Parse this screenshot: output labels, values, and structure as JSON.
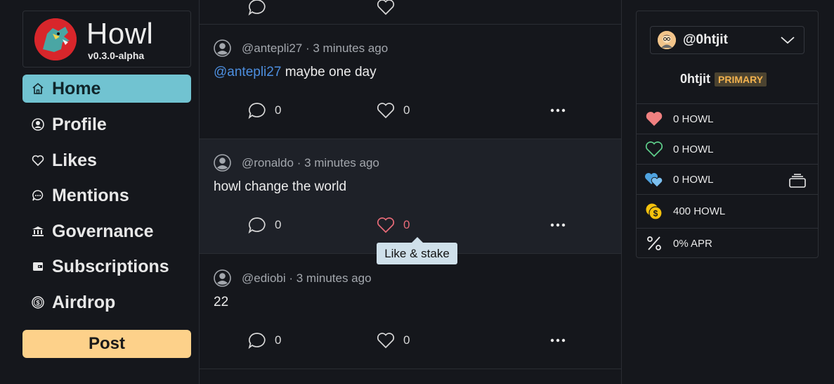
{
  "brand": {
    "name": "Howl",
    "version": "v0.3.0-alpha"
  },
  "nav": [
    {
      "label": "Home",
      "icon": "home-icon",
      "active": true
    },
    {
      "label": "Profile",
      "icon": "user-circle-icon"
    },
    {
      "label": "Likes",
      "icon": "heart-icon"
    },
    {
      "label": "Mentions",
      "icon": "chat-bubble-icon"
    },
    {
      "label": "Governance",
      "icon": "bank-icon"
    },
    {
      "label": "Subscriptions",
      "icon": "wallet-icon"
    },
    {
      "label": "Airdrop",
      "icon": "coin-icon"
    }
  ],
  "post_button": "Post",
  "posts": [
    {
      "author": "@antepli27",
      "time": "3 minutes ago",
      "mention": "@antepli27",
      "text": "maybe one day",
      "replies": "0",
      "likes": "0"
    },
    {
      "author": "@ronaldo",
      "time": "3 minutes ago",
      "mention": "",
      "text": "howl change the world",
      "replies": "0",
      "likes": "0"
    },
    {
      "author": "@ediobi",
      "time": "3 minutes ago",
      "mention": "",
      "text": "22",
      "replies": "0",
      "likes": "0"
    }
  ],
  "tooltip": "Like & stake",
  "wallet": {
    "handle": "@0htjit",
    "name": "0htjit",
    "badge": "PRIMARY",
    "rows": [
      {
        "icon": "heart-filled-icon",
        "value": "0 HOWL"
      },
      {
        "icon": "heart-outline-icon",
        "value": "0 HOWL"
      },
      {
        "icon": "hearts-icon",
        "value": "0 HOWL"
      },
      {
        "icon": "coins-icon",
        "value": "400 HOWL"
      },
      {
        "icon": "percent-icon",
        "value": "0% APR"
      }
    ]
  },
  "colors": {
    "accent": "#71c3d1",
    "post": "#fdd18a",
    "like": "#e86b78",
    "mention": "#4d8fe0"
  }
}
